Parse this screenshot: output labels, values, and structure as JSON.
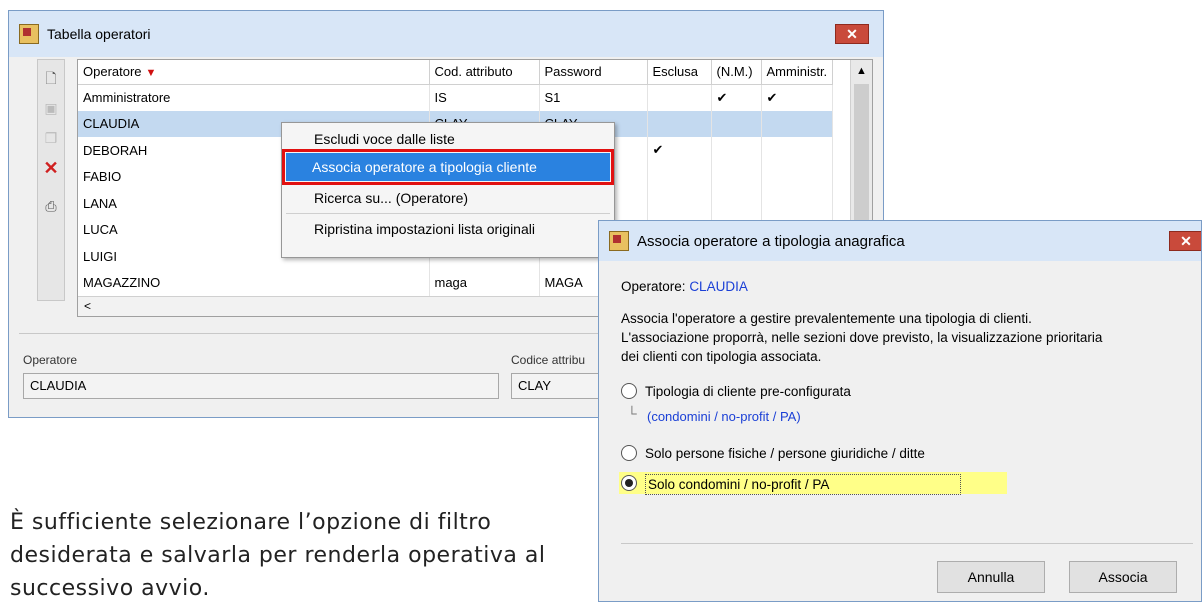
{
  "window_main": {
    "title": "Tabella operatori",
    "close_label": "✕",
    "columns": [
      "Operatore",
      "Cod. attributo",
      "Password",
      "Esclusa",
      "(N.M.)",
      "Amministr."
    ],
    "rows": [
      {
        "operatore": "Amministratore",
        "cod": "IS",
        "password": "S1",
        "esclusa": "",
        "nm": "✔",
        "amm": "✔"
      },
      {
        "operatore": "CLAUDIA",
        "cod": "CLAY",
        "password": "CLAY",
        "esclusa": "",
        "nm": "",
        "amm": ""
      },
      {
        "operatore": "DEBORAH",
        "cod": "",
        "password": "",
        "esclusa": "✔",
        "nm": "",
        "amm": ""
      },
      {
        "operatore": "FABIO",
        "cod": "",
        "password": "",
        "esclusa": "",
        "nm": "",
        "amm": ""
      },
      {
        "operatore": "LANA",
        "cod": "",
        "password": "",
        "esclusa": "",
        "nm": "",
        "amm": ""
      },
      {
        "operatore": "LUCA",
        "cod": "",
        "password": "",
        "esclusa": "",
        "nm": "",
        "amm": ""
      },
      {
        "operatore": "LUIGI",
        "cod": "",
        "password": "",
        "esclusa": "",
        "nm": "",
        "amm": ""
      },
      {
        "operatore": "MAGAZZINO",
        "cod": "maga",
        "password": "MAGA",
        "esclusa": "",
        "nm": "",
        "amm": ""
      }
    ],
    "bottom_labels": {
      "operatore": "Operatore",
      "codice": "Codice attribu"
    },
    "bottom_values": {
      "operatore": "CLAUDIA",
      "codice": "CLAY"
    }
  },
  "context_menu": {
    "items": [
      "Escludi voce dalle liste",
      "Associa operatore a tipologia cliente",
      "Ricerca su... (Operatore)",
      "Ripristina impostazioni lista originali"
    ]
  },
  "dialog": {
    "title": "Associa operatore a tipologia anagrafica",
    "close_label": "✕",
    "operatore_label": "Operatore:",
    "operatore_value": "CLAUDIA",
    "description": [
      "Associa l'operatore a gestire prevalentemente una tipologia di clienti.",
      "L'associazione proporrà, nelle sezioni dove previsto, la visualizzazione prioritaria",
      "dei clienti con tipologia associata."
    ],
    "options": [
      {
        "label": "Tipologia di cliente pre-configurata",
        "checked": false
      },
      {
        "label": "Solo persone fisiche / persone giuridiche / ditte",
        "checked": false
      },
      {
        "label": "Solo condomini / no-profit / PA",
        "checked": true
      }
    ],
    "preconfig_sublabel": "(condomini / no-profit / PA)",
    "buttons": {
      "cancel": "Annulla",
      "ok": "Associa"
    }
  },
  "caption": "È sufficiente selezionare l’opzione di filtro desiderata e salvarla per renderla operativa al successivo avvio.",
  "colors": {
    "accent": "#2a82e0",
    "highlight_border": "#e11010",
    "link_blue": "#1a3fd6",
    "option_highlight": "#ffff88"
  }
}
